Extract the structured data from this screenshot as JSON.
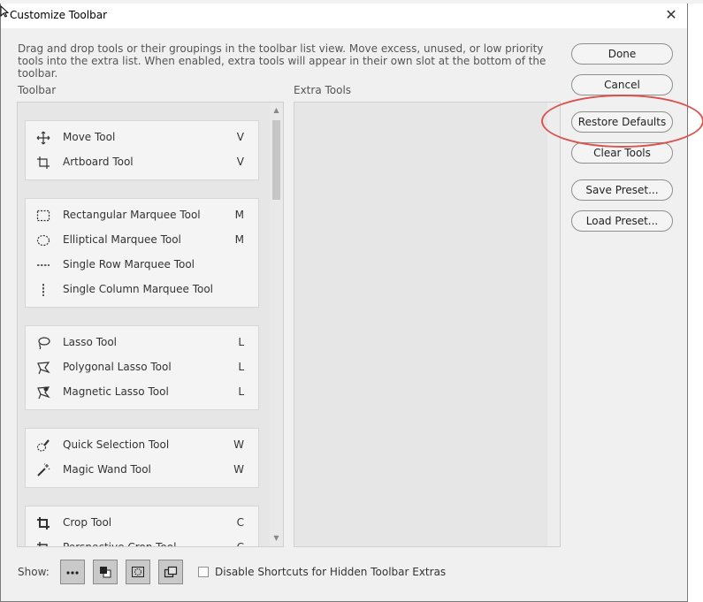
{
  "dialog": {
    "title": "Customize Toolbar",
    "close_glyph": "✕",
    "description": "Drag and drop tools or their groupings in the toolbar list view. Move excess, unused, or low priority tools into the extra list. When enabled, extra tools will appear in their own slot at the bottom of the toolbar."
  },
  "toolbar_label": "Toolbar",
  "extra_tools_label": "Extra Tools",
  "tool_groups": [
    {
      "tools": [
        {
          "name": "Move Tool",
          "key": "V",
          "icon": "move-icon"
        },
        {
          "name": "Artboard Tool",
          "key": "V",
          "icon": "artboard-icon"
        }
      ]
    },
    {
      "tools": [
        {
          "name": "Rectangular Marquee Tool",
          "key": "M",
          "icon": "rect-marquee-icon"
        },
        {
          "name": "Elliptical Marquee Tool",
          "key": "M",
          "icon": "ellipse-marquee-icon"
        },
        {
          "name": "Single Row Marquee Tool",
          "key": "",
          "icon": "single-row-icon"
        },
        {
          "name": "Single Column Marquee Tool",
          "key": "",
          "icon": "single-column-icon"
        }
      ]
    },
    {
      "tools": [
        {
          "name": "Lasso Tool",
          "key": "L",
          "icon": "lasso-icon"
        },
        {
          "name": "Polygonal Lasso Tool",
          "key": "L",
          "icon": "polygonal-lasso-icon"
        },
        {
          "name": "Magnetic Lasso Tool",
          "key": "L",
          "icon": "magnetic-lasso-icon"
        }
      ]
    },
    {
      "tools": [
        {
          "name": "Quick Selection Tool",
          "key": "W",
          "icon": "quick-selection-icon"
        },
        {
          "name": "Magic Wand Tool",
          "key": "W",
          "icon": "magic-wand-icon"
        }
      ]
    },
    {
      "tools": [
        {
          "name": "Crop Tool",
          "key": "C",
          "icon": "crop-icon"
        },
        {
          "name": "Perspective Crop Tool",
          "key": "C",
          "icon": "perspective-crop-icon"
        }
      ]
    }
  ],
  "buttons": {
    "done": "Done",
    "cancel": "Cancel",
    "restore_defaults": "Restore Defaults",
    "clear_tools": "Clear Tools",
    "save_preset": "Save Preset...",
    "load_preset": "Load Preset..."
  },
  "footer": {
    "show_label": "Show:",
    "show_buttons": [
      "more-options-icon",
      "foreground-background-icon",
      "quick-mask-icon",
      "screen-mode-icon"
    ],
    "checkbox_label": "Disable Shortcuts for Hidden Toolbar Extras",
    "checkbox_checked": false
  },
  "colors": {
    "highlight": "#d9534f"
  }
}
